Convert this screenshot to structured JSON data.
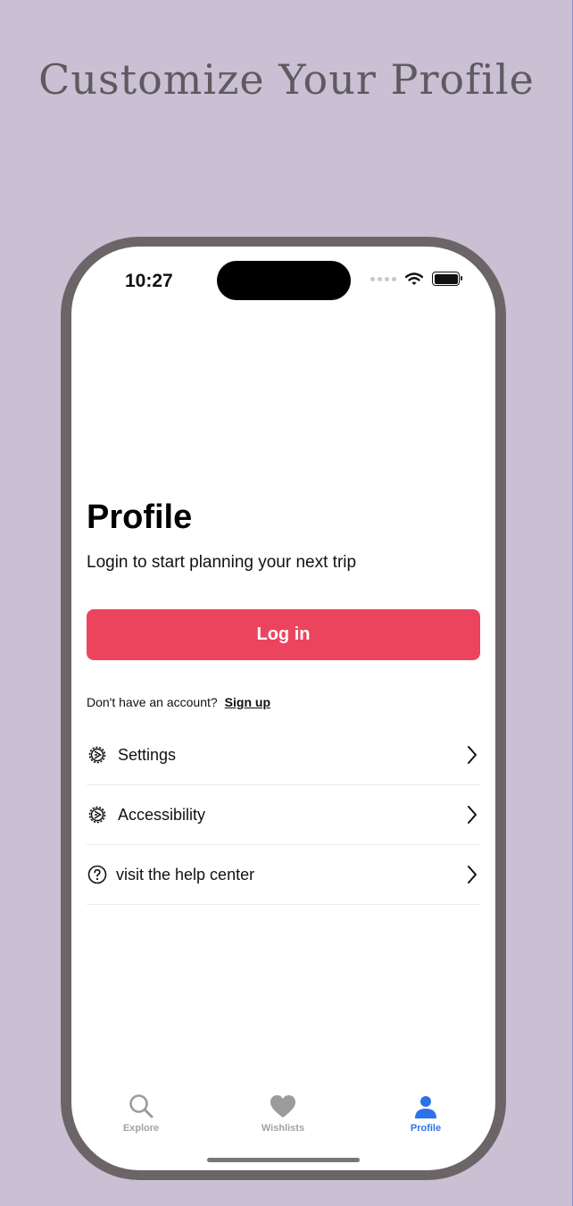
{
  "headline": "Customize Your Profile",
  "status_bar": {
    "time": "10:27"
  },
  "profile": {
    "title": "Profile",
    "subtitle": "Login to start planning your next trip",
    "login_label": "Log in",
    "no_account_text": "Don't have an account?",
    "signup_label": "Sign up"
  },
  "menu": [
    {
      "label": "Settings",
      "icon": "gear-icon"
    },
    {
      "label": "Accessibility",
      "icon": "gear-icon"
    },
    {
      "label": "visit the help center",
      "icon": "question-circle-icon"
    }
  ],
  "tabs": [
    {
      "label": "Explore",
      "icon": "search-icon",
      "active": false
    },
    {
      "label": "Wishlists",
      "icon": "heart-icon",
      "active": false
    },
    {
      "label": "Profile",
      "icon": "person-icon",
      "active": true
    }
  ],
  "colors": {
    "background": "#c9c0d3",
    "accent": "#ec445e",
    "active_tab": "#2d73e8",
    "inactive_tab": "#a3a3a3"
  }
}
